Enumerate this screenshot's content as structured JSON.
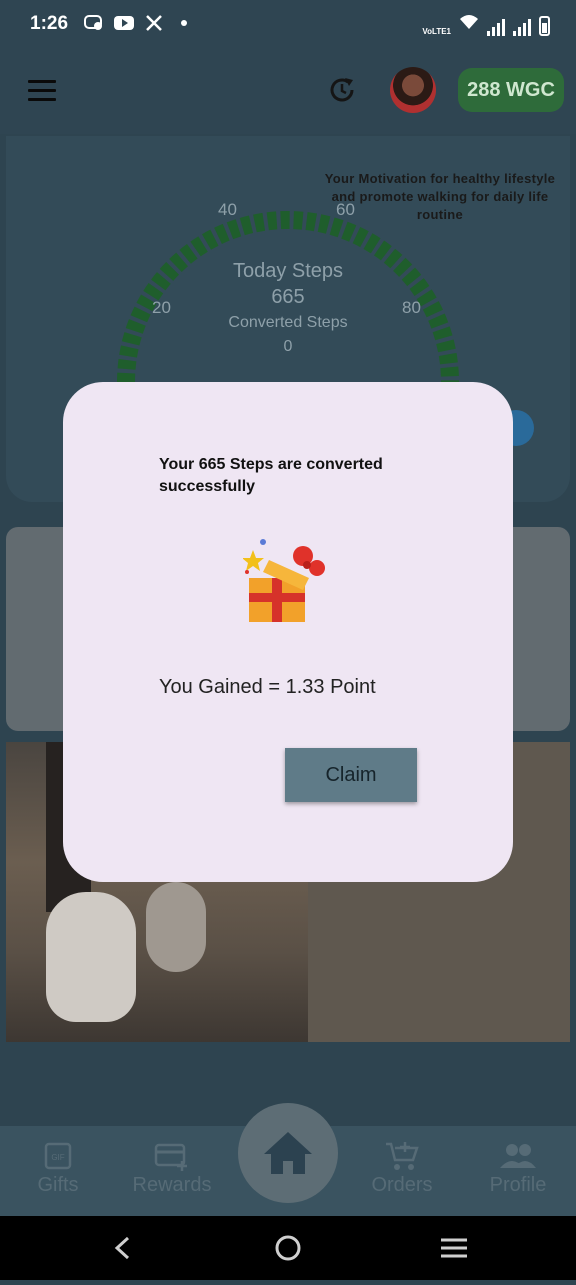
{
  "status_bar": {
    "time": "1:26",
    "network": "VoLTE1"
  },
  "header": {
    "balance": "288 WGC"
  },
  "gauge": {
    "title": "Today Steps",
    "steps": "665",
    "converted_label": "Converted Steps",
    "converted_value": "0",
    "ticks": [
      "20",
      "40",
      "60",
      "80"
    ]
  },
  "banner": {
    "text": "Your Motivation for healthy lifestyle and promote walking for daily life routine"
  },
  "dialog": {
    "message": "Your 665 Steps are converted successfully",
    "gained": "You Gained = 1.33 Point",
    "claim_label": "Claim"
  },
  "nav": {
    "items": [
      {
        "label": "Gifts",
        "icon": "gif-icon"
      },
      {
        "label": "Rewards",
        "icon": "card-plus-icon"
      },
      {
        "label": "Home",
        "icon": "home-icon"
      },
      {
        "label": "Orders",
        "icon": "cart-plus-icon"
      },
      {
        "label": "Profile",
        "icon": "people-icon"
      }
    ]
  },
  "colors": {
    "accent_green": "#2e6b3a",
    "dialog_bg": "#efe6f3",
    "claim_bg": "#5f7b88"
  }
}
